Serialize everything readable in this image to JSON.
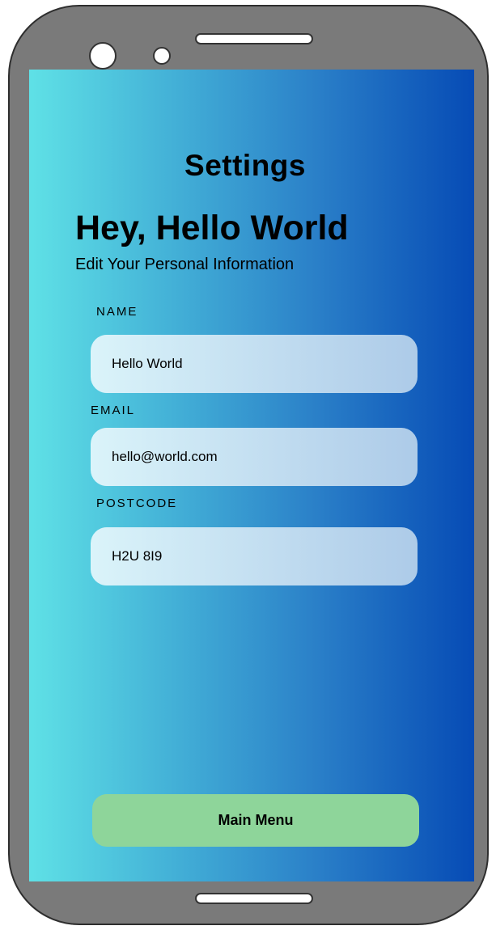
{
  "header": {
    "title": "Settings",
    "greeting": "Hey, Hello World",
    "subtitle": "Edit Your Personal Information"
  },
  "form": {
    "name": {
      "label": "NAME",
      "value": "Hello World"
    },
    "email": {
      "label": "EMAIL",
      "value": "hello@world.com"
    },
    "postcode": {
      "label": "POSTCODE",
      "value": "H2U 8I9"
    }
  },
  "actions": {
    "main_menu_label": "Main Menu"
  },
  "colors": {
    "gradient_start": "#5fe1e6",
    "gradient_end": "#064bb5",
    "button": "#8ed59a",
    "device_frame": "#7a7a7a"
  }
}
